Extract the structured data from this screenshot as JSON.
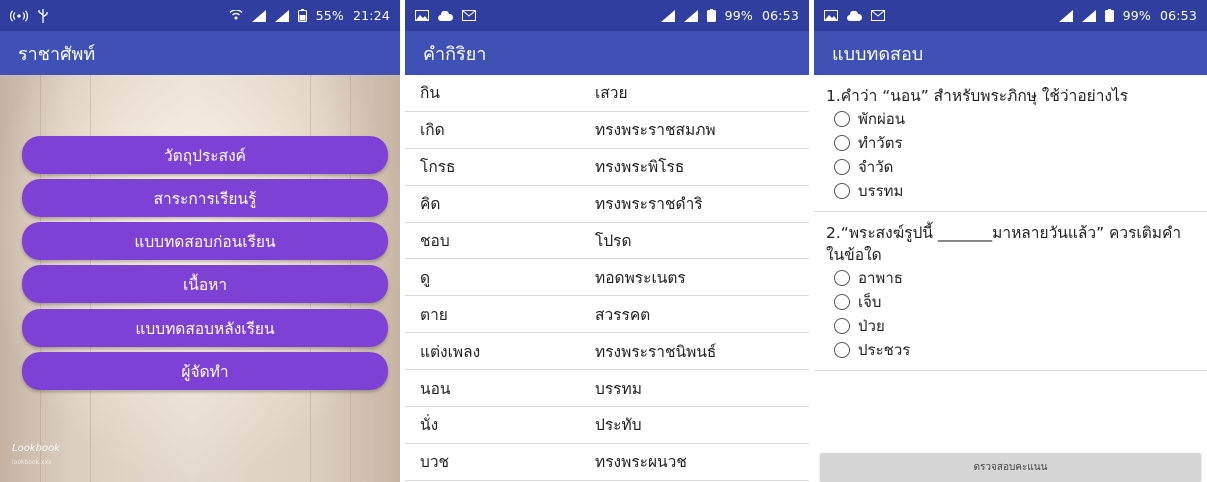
{
  "screen1": {
    "status": {
      "battery": "55%",
      "time": "21:24",
      "network": "3G"
    },
    "title": "ราชาศัพท์",
    "menu": [
      "วัตถุประสงค์",
      "สาระการเรียนรู้",
      "แบบทดสอบก่อนเรียน",
      "เนื้อหา",
      "แบบทดสอบหลังเรียน",
      "ผู้จัดทำ"
    ],
    "watermark": "Lookbook",
    "watermark_sub": "lookbook.xxx"
  },
  "screen2": {
    "status": {
      "battery": "99%",
      "time": "06:53",
      "network": "3G"
    },
    "title": "คำกิริยา",
    "rows": [
      [
        "กิน",
        "เสวย"
      ],
      [
        "เกิด",
        "ทรงพระราชสมภพ"
      ],
      [
        "โกรธ",
        "ทรงพระพิโรธ"
      ],
      [
        "คิด",
        "ทรงพระราชดำริ"
      ],
      [
        "ชอบ",
        "โปรด"
      ],
      [
        "ดู",
        "ทอดพระเนตร"
      ],
      [
        "ตาย",
        "สวรรคต"
      ],
      [
        "แต่งเพลง",
        "ทรงพระราชนิพนธ์"
      ],
      [
        "นอน",
        "บรรทม"
      ],
      [
        "นั่ง",
        "ประทับ"
      ],
      [
        "บวช",
        "ทรงพระผนวช"
      ]
    ]
  },
  "screen3": {
    "status": {
      "battery": "99%",
      "time": "06:53",
      "network": "3G"
    },
    "title": "แบบทดสอบ",
    "questions": [
      {
        "text": "1.คำว่า “นอน” สำหรับพระภิกษุ ใช้ว่าอย่างไร",
        "options": [
          "พักผ่อน",
          "ทำวัตร",
          "จำวัด",
          "บรรทม"
        ]
      },
      {
        "text": "2.“พระสงฆ์รูปนี้ _______มาหลายวันแล้ว” ควรเติมคำในข้อใด",
        "options": [
          "อาพาธ",
          "เจ็บ",
          "ป่วย",
          "ประชวร"
        ]
      }
    ],
    "submit_label": "ตรวจสอบคะแนน"
  }
}
